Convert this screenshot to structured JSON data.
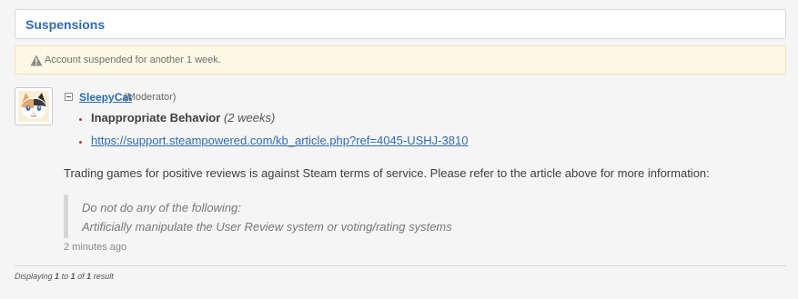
{
  "header": {
    "title": "Suspensions"
  },
  "alert": {
    "icon": "warning-icon",
    "text": "Account suspended for another 1 week."
  },
  "entry": {
    "avatar_icon": "cat-avatar",
    "username": "SleepyCat",
    "role": "(Moderator)",
    "reason_label": "Inappropriate Behavior",
    "reason_duration": "(2 weeks)",
    "article_url": "https://support.steampowered.com/kb_article.php?ref=4045-USHJ-3810",
    "message": "Trading games for positive reviews is against Steam terms of service. Please refer to the article above for more information:",
    "quote_lines": [
      "Do not do any of the following:",
      "Artificially manipulate the User Review system or voting/rating systems"
    ],
    "timestamp": "2 minutes ago"
  },
  "pagination": {
    "prefix": "Displaying",
    "from": "1",
    "to_word": "to",
    "to": "1",
    "of_word": "of",
    "total": "1",
    "suffix": "result"
  },
  "colors": {
    "link": "#2f6bb3",
    "alert_bg": "#fcf8e3",
    "bullet": "#c0392b"
  }
}
